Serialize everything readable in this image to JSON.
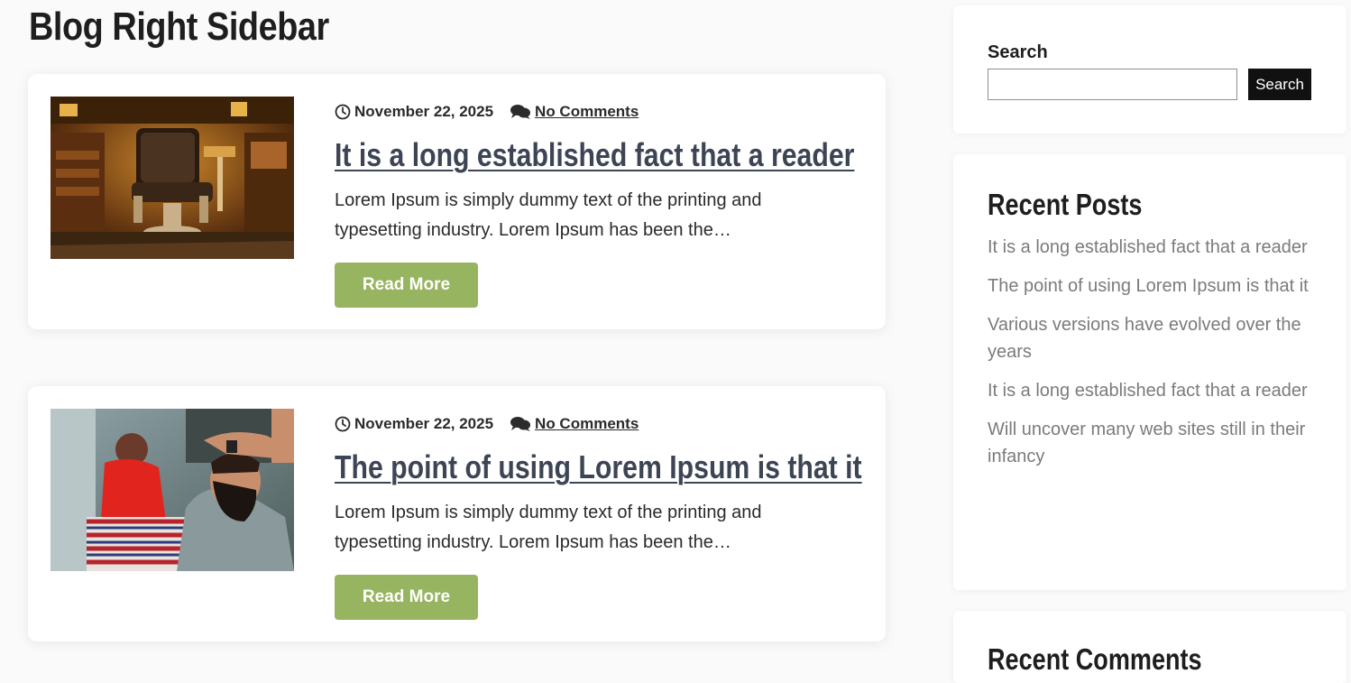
{
  "page": {
    "title": "Blog Right Sidebar"
  },
  "posts": [
    {
      "date": "November 22, 2025",
      "comments": "No Comments",
      "title": "It is a long established fact that a reader",
      "excerpt": "Lorem Ipsum is simply dummy text of the printing and typesetting industry. Lorem Ipsum has been the…",
      "read_more": "Read More",
      "image": "barber-chair-photo"
    },
    {
      "date": "November 22, 2025",
      "comments": "No Comments",
      "title": "The point of using Lorem Ipsum is that it",
      "excerpt": "Lorem Ipsum is simply dummy text of the printing and typesetting industry. Lorem Ipsum has been the…",
      "read_more": "Read More",
      "image": "barber-haircut-photo"
    }
  ],
  "sidebar": {
    "search": {
      "label": "Search",
      "value": "",
      "button": "Search"
    },
    "recent_posts": {
      "title": "Recent Posts",
      "items": [
        "It is a long established fact that a reader",
        "The point of using Lorem Ipsum is that it",
        "Various versions have evolved over the years",
        "It is a long established fact that a reader",
        "Will uncover many web sites still in their infancy"
      ]
    },
    "recent_comments": {
      "title": "Recent Comments"
    }
  },
  "icons": {
    "date": "clock-icon",
    "comments": "comments-icon"
  },
  "colors": {
    "accent": "#97b460",
    "title_link": "#3d4555",
    "sidebar_link": "#7b7b7b",
    "search_button": "#111111"
  }
}
